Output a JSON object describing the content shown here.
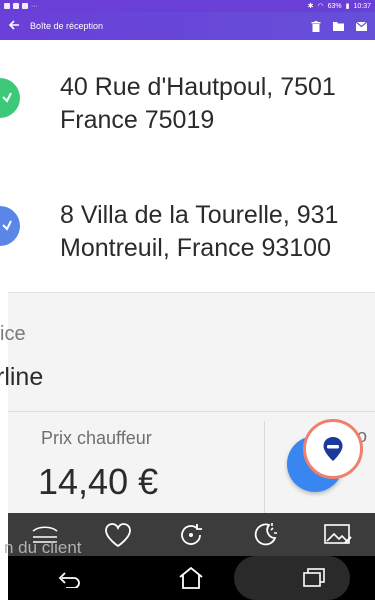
{
  "status_bar": {
    "battery": "63%",
    "time": "10:37"
  },
  "app_bar": {
    "title": "Boîte de réception",
    "icons": [
      "back-arrow-icon",
      "trash-icon",
      "folder-icon",
      "mail-icon"
    ]
  },
  "route": {
    "pickup": {
      "line1": "40 Rue d'Hautpoul, 7501",
      "line2": "France 75019"
    },
    "dropoff": {
      "line1": "8 Villa de la Tourelle, 931",
      "line2": "Montreuil, France 93100"
    }
  },
  "service": {
    "label": "vice",
    "value": "rline"
  },
  "price": {
    "label": "Prix chauffeur",
    "value": "14,40 €",
    "side_label_fragment": "o"
  },
  "bottom_text_fragment": "n du client",
  "toolbar": {
    "icons": [
      "menu-icon",
      "heart-icon",
      "rotate-icon",
      "night-mode-icon",
      "image-edit-icon"
    ]
  },
  "nav_bar": {
    "icons": [
      "back-icon",
      "home-icon",
      "recents-icon"
    ]
  },
  "colors": {
    "header_gradient_start": "#6a3fd8",
    "header_gradient_end": "#6650d8",
    "green_pin": "#3ec97a",
    "blue_pin": "#5a86e8",
    "fab_blue": "#3a86f0",
    "highlight_ring": "#f07f6e",
    "marker_blue": "#1a3b9a"
  }
}
